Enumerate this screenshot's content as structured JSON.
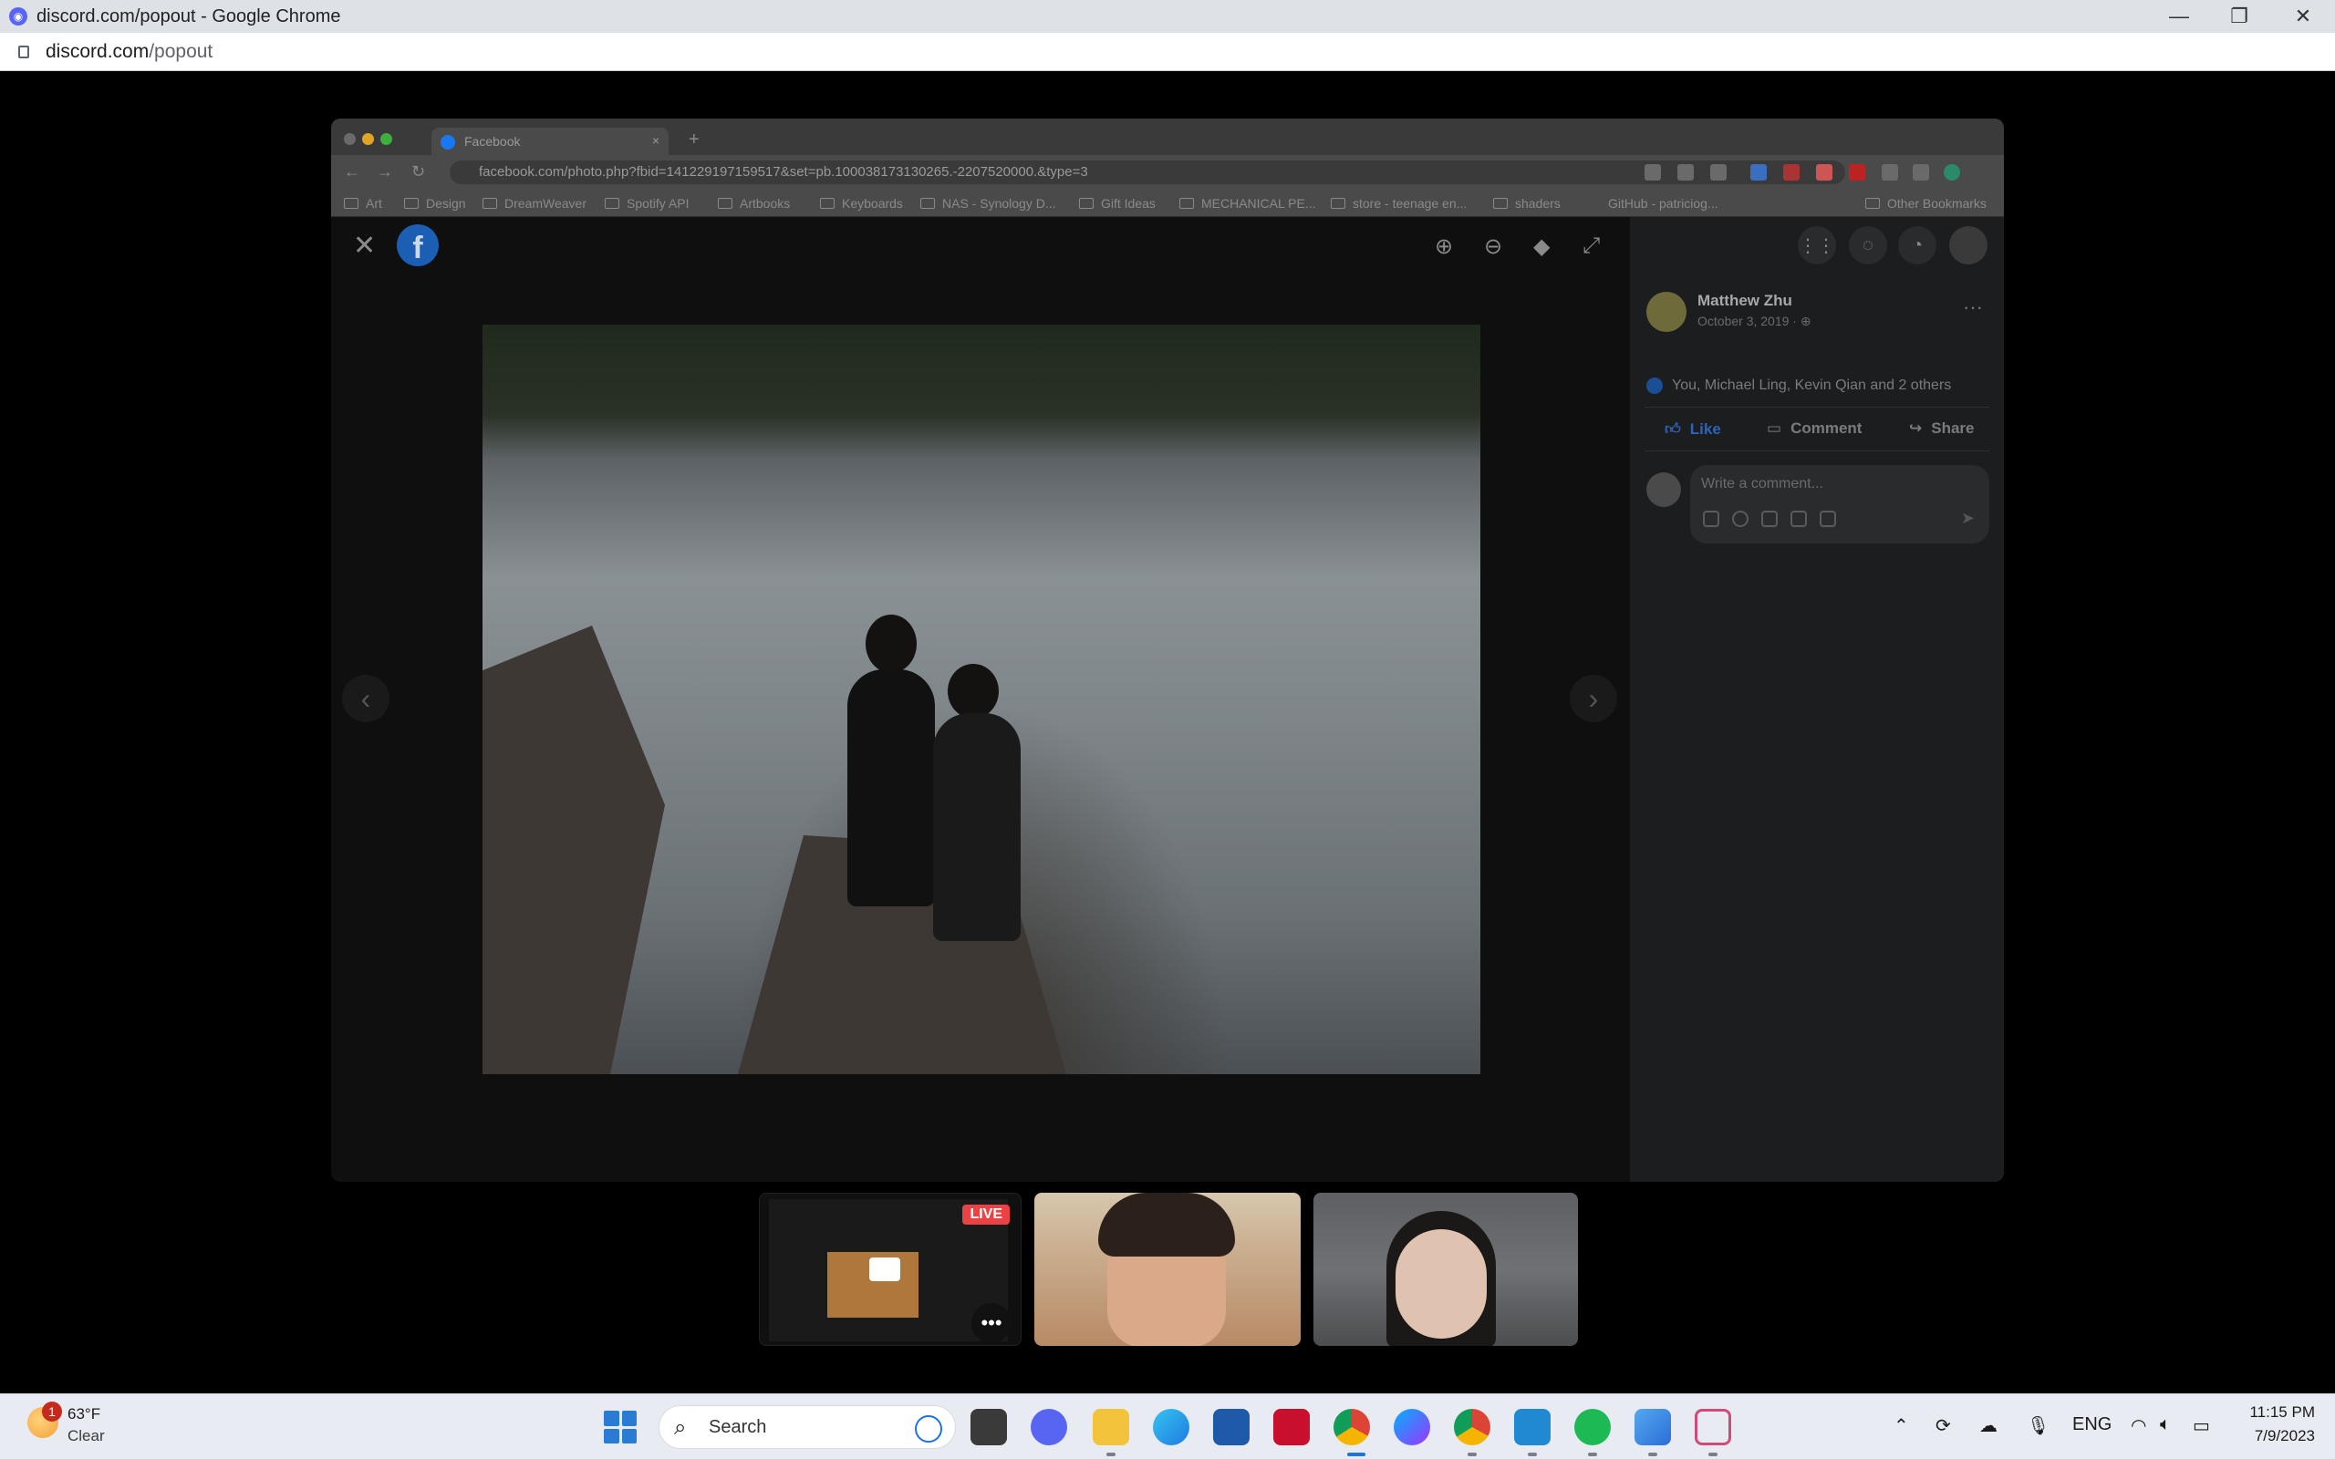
{
  "outer_window": {
    "title": "discord.com/popout - Google Chrome",
    "url_host": "discord.com",
    "url_path": "/popout",
    "controls": {
      "minimize": "—",
      "restore": "❐",
      "close": "✕"
    }
  },
  "shared_screen": {
    "tab_title": "Facebook",
    "new_tab": "+",
    "url": "facebook.com/photo.php?fbid=141229197159517&set=pb.100038173130265.-2207520000.&type=3",
    "bookmarks": [
      "Art",
      "Design",
      "DreamWeaver",
      "Spotify API",
      "Artbooks",
      "Keyboards",
      "NAS - Synology D...",
      "Gift Ideas",
      "MECHANICAL PE...",
      "store - teenage en...",
      "shaders",
      "GitHub - patriciog...",
      "Other Bookmarks"
    ]
  },
  "facebook": {
    "close_icon": "✕",
    "logo_letter": "f",
    "nav_prev": "‹",
    "nav_next": "›",
    "author": "Matthew Zhu",
    "date": "October 3, 2019 · ⊕",
    "more": "···",
    "likes_text": "You, Michael Ling, Kevin Qian and 2 others",
    "actions": {
      "like": "Like",
      "comment": "Comment",
      "share": "Share"
    },
    "comment_placeholder": "Write a comment...",
    "colors": {
      "like_active": "#2d62b8",
      "action": "#7a7b7c"
    }
  },
  "call": {
    "live_badge": "LIVE",
    "more": "•••"
  },
  "taskbar": {
    "weather_badge": "1",
    "temperature": "63°F",
    "condition": "Clear",
    "search_label": "Search",
    "language": "ENG",
    "time": "11:15 PM",
    "date": "7/9/2023",
    "apps": [
      "file-explorer",
      "discord",
      "file-folder",
      "edge",
      "microsoft-store",
      "mcafee",
      "chrome",
      "messenger",
      "chrome-alt",
      "vscode",
      "spotify",
      "photos",
      "snipping-tool"
    ]
  }
}
